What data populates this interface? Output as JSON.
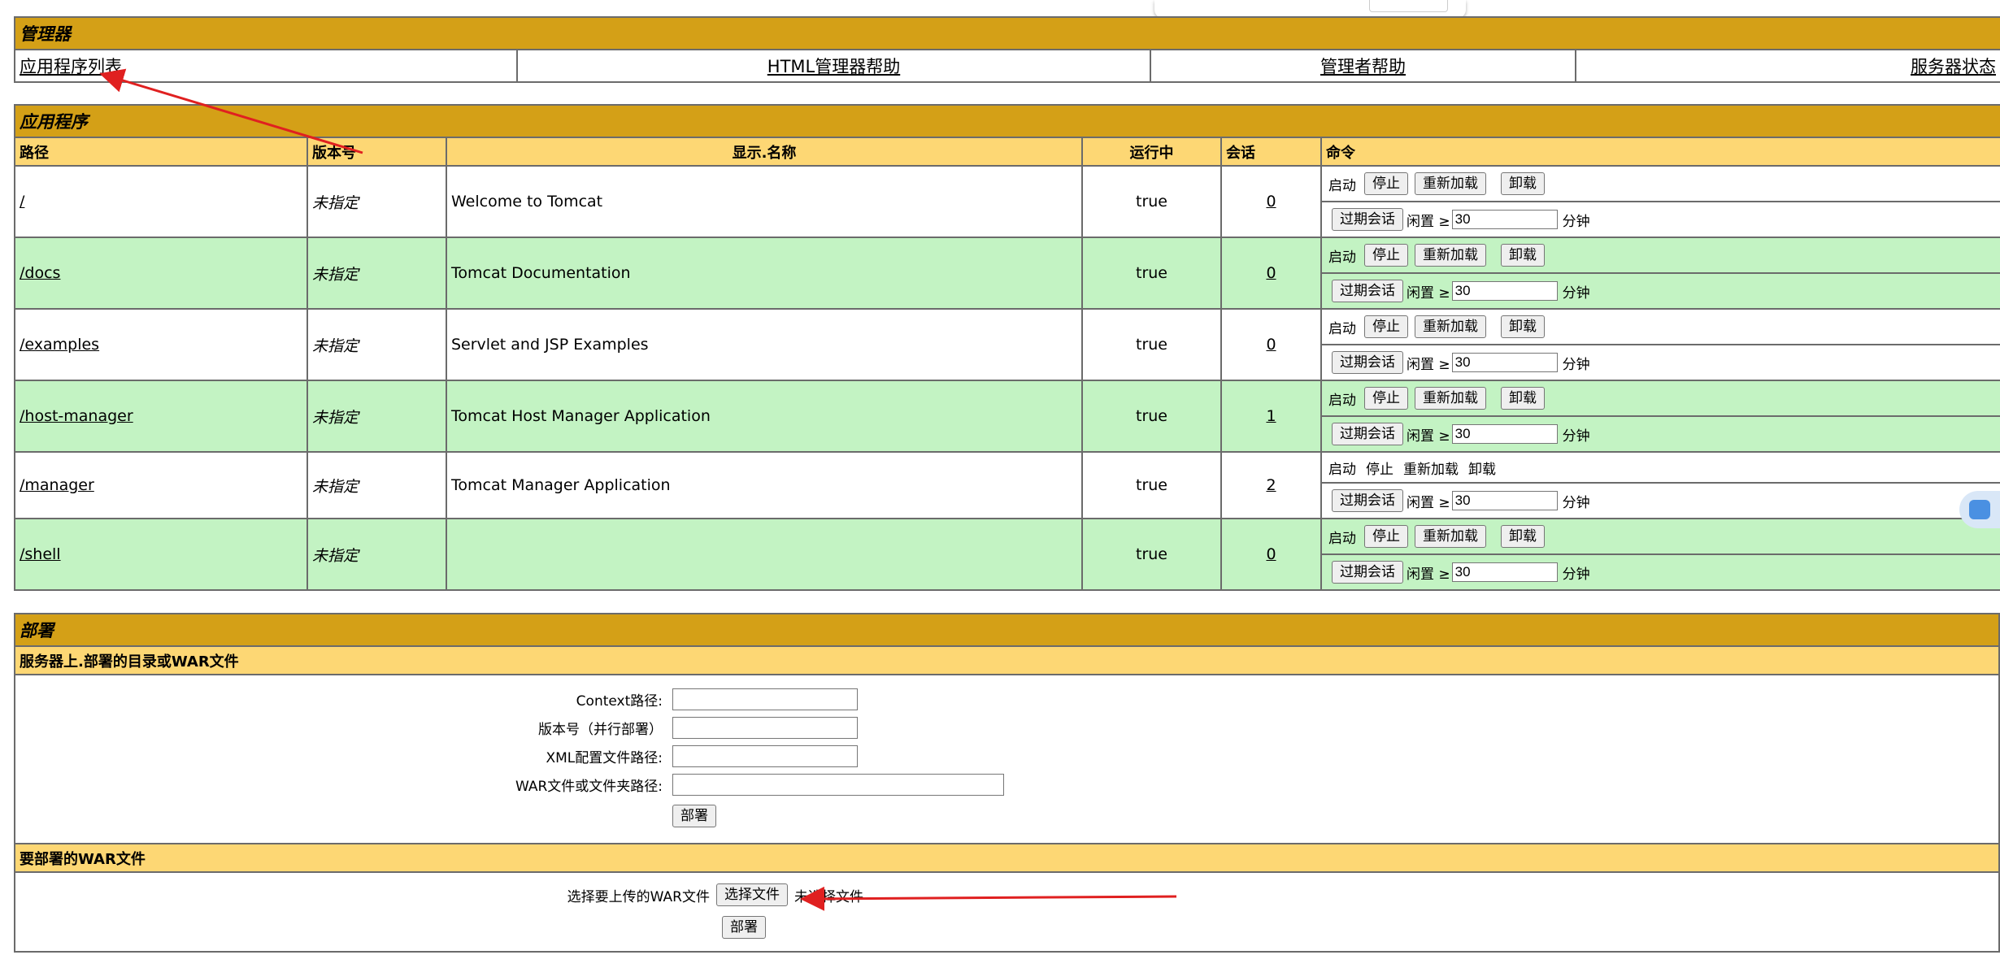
{
  "manager": {
    "title": "管理器",
    "nav": [
      "应用程序列表",
      "HTML管理器帮助",
      "管理者帮助",
      "服务器状态"
    ]
  },
  "applications": {
    "title": "应用程序",
    "headers": [
      "路径",
      "版本号",
      "显示.名称",
      "运行中",
      "会话",
      "命令"
    ],
    "rows": [
      {
        "path": "/",
        "version": "未指定",
        "name": "Welcome to Tomcat",
        "running": "true",
        "sessions": "0"
      },
      {
        "path": "/docs",
        "version": "未指定",
        "name": "Tomcat Documentation",
        "running": "true",
        "sessions": "0"
      },
      {
        "path": "/examples",
        "version": "未指定",
        "name": "Servlet and JSP Examples",
        "running": "true",
        "sessions": "0"
      },
      {
        "path": "/host-manager",
        "version": "未指定",
        "name": "Tomcat Host Manager Application",
        "running": "true",
        "sessions": "1"
      },
      {
        "path": "/manager",
        "version": "未指定",
        "name": "Tomcat Manager Application",
        "running": "true",
        "sessions": "2"
      },
      {
        "path": "/shell",
        "version": "未指定",
        "name": "",
        "running": "true",
        "sessions": "0"
      }
    ],
    "commands": {
      "start": "启动",
      "stop": "停止",
      "reload": "重新加载",
      "undeploy": "卸载",
      "expire": "过期会话",
      "idle": "闲置 ≥",
      "idle_value": "30",
      "minutes": "分钟"
    }
  },
  "deploy": {
    "title": "部署",
    "server_section": "服务器上.部署的目录或WAR文件",
    "context_label": "Context路径:",
    "version_label": "版本号（并行部署）",
    "xml_label": "XML配置文件路径:",
    "war_label": "WAR文件或文件夹路径:",
    "deploy_button": "部署",
    "war_section": "要部署的WAR文件",
    "choose_label": "选择要上传的WAR文件",
    "choose_button": "选择文件",
    "no_file": "未选择文件",
    "upload_button": "部署"
  }
}
